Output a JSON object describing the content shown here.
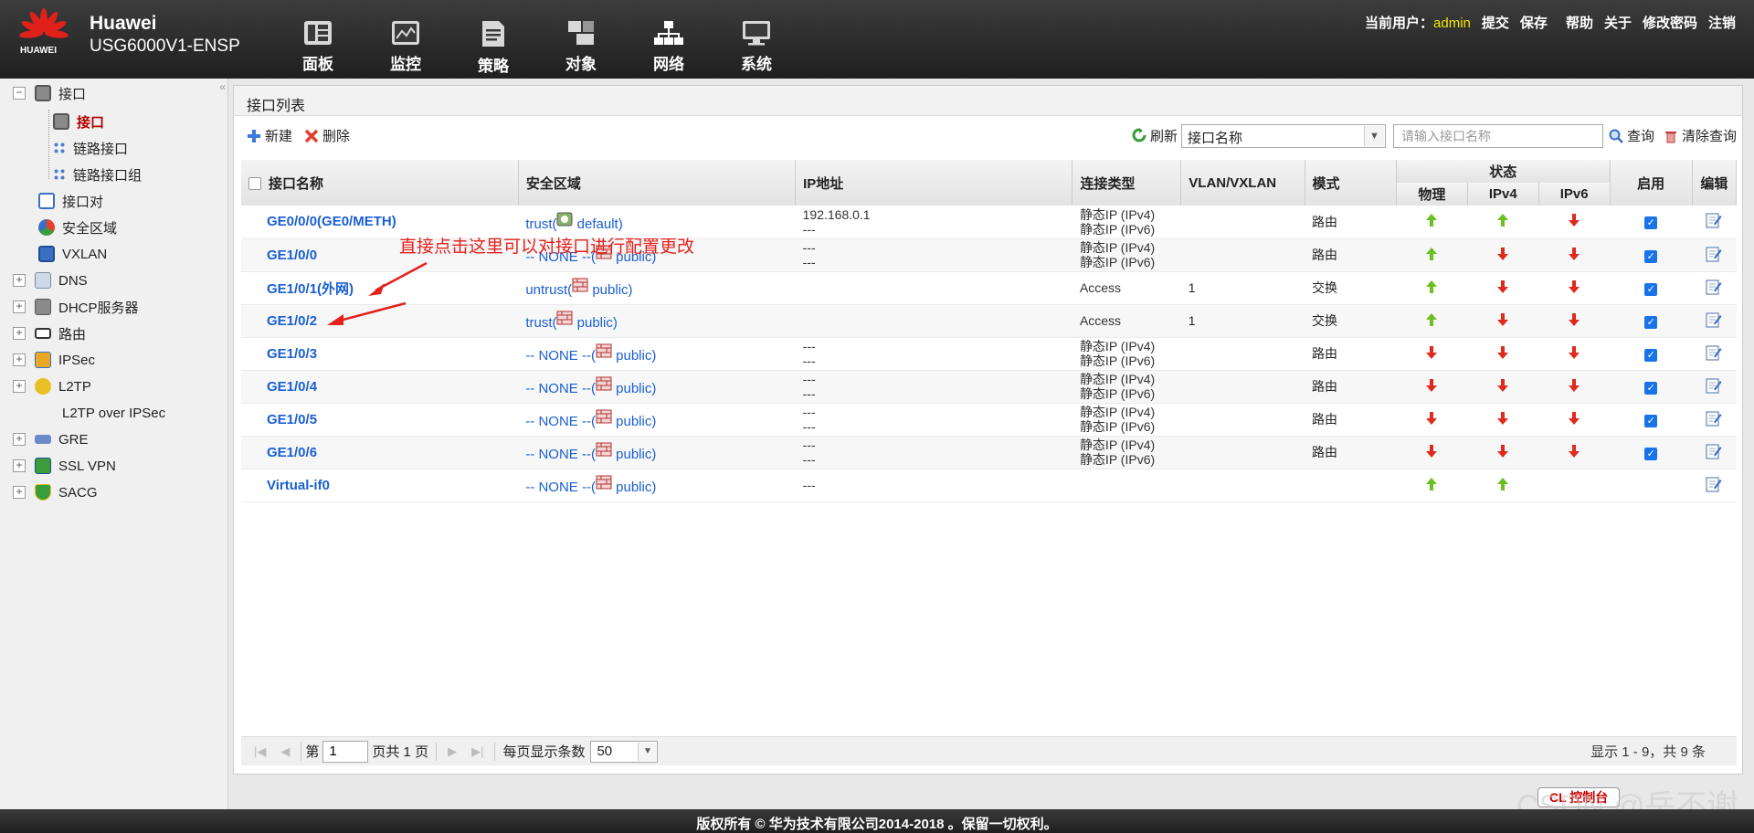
{
  "header": {
    "logo_text": "HUAWEI",
    "brand": "Huawei",
    "model": "USG6000V1-ENSP",
    "nav": [
      {
        "label": "面板",
        "icon": "dashboard-icon"
      },
      {
        "label": "监控",
        "icon": "monitor-icon"
      },
      {
        "label": "策略",
        "icon": "policy-icon"
      },
      {
        "label": "对象",
        "icon": "object-icon"
      },
      {
        "label": "网络",
        "icon": "network-icon"
      },
      {
        "label": "系统",
        "icon": "system-icon"
      }
    ],
    "current_user_label": "当前用户：",
    "current_user": "admin",
    "links": [
      "提交",
      "保存",
      "帮助",
      "关于",
      "修改密码",
      "注销"
    ]
  },
  "sidebar": {
    "items": [
      {
        "label": "接口"
      },
      {
        "label": "接口"
      },
      {
        "label": "链路接口"
      },
      {
        "label": "链路接口组"
      },
      {
        "label": "接口对"
      },
      {
        "label": "安全区域"
      },
      {
        "label": "VXLAN"
      },
      {
        "label": "DNS"
      },
      {
        "label": "DHCP服务器"
      },
      {
        "label": "路由"
      },
      {
        "label": "IPSec"
      },
      {
        "label": "L2TP"
      },
      {
        "label": "L2TP over IPSec"
      },
      {
        "label": "GRE"
      },
      {
        "label": "SSL VPN"
      },
      {
        "label": "SACG"
      }
    ]
  },
  "panel": {
    "title": "接口列表",
    "toolbar": {
      "new_label": "新建",
      "delete_label": "删除",
      "refresh_label": "刷新",
      "filter_select": "接口名称",
      "search_placeholder": "请输入接口名称",
      "query_label": "查询",
      "clear_label": "清除查询"
    },
    "columns": {
      "name": "接口名称",
      "zone": "安全区域",
      "ip": "IP地址",
      "conn_type": "连接类型",
      "vlan": "VLAN/VXLAN",
      "mode": "模式",
      "status": "状态",
      "physical": "物理",
      "ipv4": "IPv4",
      "ipv6": "IPv6",
      "enable": "启用",
      "edit": "编辑"
    },
    "rows": [
      {
        "name": "GE0/0/0(GE0/METH)",
        "zone_a": "trust(",
        "zone_b": "default)",
        "ip1": "192.168.0.1",
        "ip2": "---",
        "ct1": "静态IP (IPv4)",
        "ct2": "静态IP (IPv6)",
        "vlan": "",
        "mode": "路由",
        "phy": "up",
        "v4": "up",
        "v6": "down",
        "enabled": true
      },
      {
        "name": "GE1/0/0",
        "zone_a": "-- NONE --(",
        "zone_b": "public)",
        "ip1": "---",
        "ip2": "---",
        "ct1": "静态IP (IPv4)",
        "ct2": "静态IP (IPv6)",
        "vlan": "",
        "mode": "路由",
        "phy": "up",
        "v4": "down",
        "v6": "down",
        "enabled": true
      },
      {
        "name": "GE1/0/1(外网)",
        "zone_a": "untrust(",
        "zone_b": "public)",
        "ip1": "",
        "ip2": "",
        "ct1": "Access",
        "ct2": "",
        "vlan": "1",
        "mode": "交换",
        "phy": "up",
        "v4": "down",
        "v6": "down",
        "enabled": true
      },
      {
        "name": "GE1/0/2",
        "zone_a": "trust(",
        "zone_b": "public)",
        "ip1": "",
        "ip2": "",
        "ct1": "Access",
        "ct2": "",
        "vlan": "1",
        "mode": "交换",
        "phy": "up",
        "v4": "down",
        "v6": "down",
        "enabled": true
      },
      {
        "name": "GE1/0/3",
        "zone_a": "-- NONE --(",
        "zone_b": "public)",
        "ip1": "---",
        "ip2": "---",
        "ct1": "静态IP (IPv4)",
        "ct2": "静态IP (IPv6)",
        "vlan": "",
        "mode": "路由",
        "phy": "down",
        "v4": "down",
        "v6": "down",
        "enabled": true
      },
      {
        "name": "GE1/0/4",
        "zone_a": "-- NONE --(",
        "zone_b": "public)",
        "ip1": "---",
        "ip2": "---",
        "ct1": "静态IP (IPv4)",
        "ct2": "静态IP (IPv6)",
        "vlan": "",
        "mode": "路由",
        "phy": "down",
        "v4": "down",
        "v6": "down",
        "enabled": true
      },
      {
        "name": "GE1/0/5",
        "zone_a": "-- NONE --(",
        "zone_b": "public)",
        "ip1": "---",
        "ip2": "---",
        "ct1": "静态IP (IPv4)",
        "ct2": "静态IP (IPv6)",
        "vlan": "",
        "mode": "路由",
        "phy": "down",
        "v4": "down",
        "v6": "down",
        "enabled": true
      },
      {
        "name": "GE1/0/6",
        "zone_a": "-- NONE --(",
        "zone_b": "public)",
        "ip1": "---",
        "ip2": "---",
        "ct1": "静态IP (IPv4)",
        "ct2": "静态IP (IPv6)",
        "vlan": "",
        "mode": "路由",
        "phy": "down",
        "v4": "down",
        "v6": "down",
        "enabled": true
      },
      {
        "name": "Virtual-if0",
        "zone_a": "-- NONE --(",
        "zone_b": "public)",
        "ip1": "---",
        "ip2": "",
        "ct1": "",
        "ct2": "",
        "vlan": "",
        "mode": "",
        "phy": "up",
        "v4": "up",
        "v6": "",
        "enabled": null
      }
    ],
    "annotation": "直接点击这里可以对接口进行配置更改",
    "pager": {
      "page_prefix": "第",
      "page_value": "1",
      "page_suffix": "页共 1 页",
      "page_size_label": "每页显示条数",
      "page_size": "50",
      "count_text": "显示 1 - 9，共 9 条"
    }
  },
  "console_label": "CL 控制台",
  "watermark": "CSDN @岳不谢",
  "footer": "版权所有 © 华为技术有限公司2014-2018 。保留一切权利。",
  "colors": {
    "up": "#6bbf1f",
    "down": "#e02a1e",
    "link": "#1a5fd3",
    "annotation": "#e5211b"
  }
}
